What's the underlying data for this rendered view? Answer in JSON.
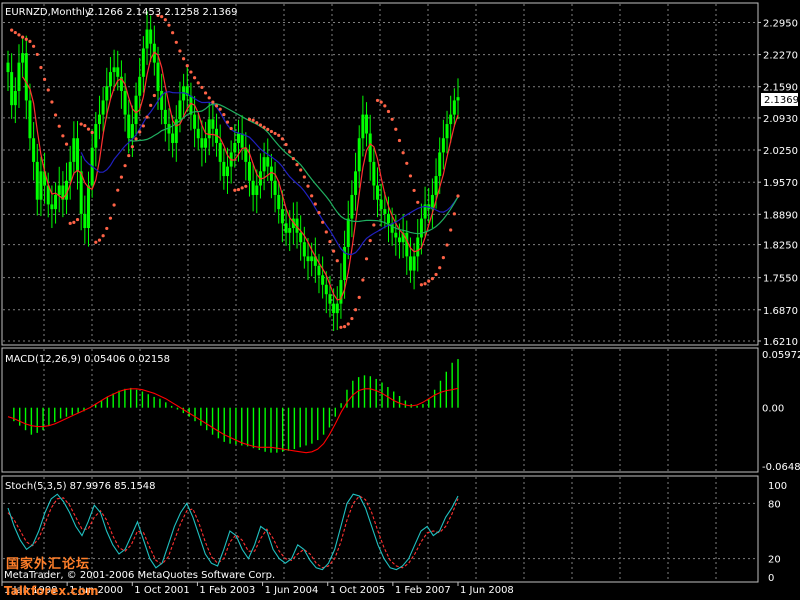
{
  "colors": {
    "background": "#000000",
    "grid": "#7f7f7f",
    "frame": "#c0c0c0",
    "text": "#ffffff",
    "candles": "#00ff00",
    "sar": "#ff6347",
    "ma_fast": "#ff3030",
    "ma_mid": "#2020c0",
    "ma_slow": "#20b060",
    "macd_hist": "#00ff00",
    "macd_signal": "#ff0000",
    "stoch_main": "#20c0c0",
    "stoch_signal": "#ff3030",
    "price_label_bg": "#ffffff",
    "price_label_text": "#000000",
    "watermark": "#ff7f2a"
  },
  "header": {
    "symbol_label": "EURNZD,Monthly",
    "ohlc_label": "2.1266 2.1453 2.1258 2.1369",
    "current_price": "2.1369"
  },
  "macd": {
    "label": "MACD(12,26,9) 0.05406 0.02158",
    "ticks": [
      "0.05972",
      "0.00",
      "-0.06483"
    ]
  },
  "stoch": {
    "label": "Stoch(5,3,5) 87.9976 85.1548",
    "ticks": [
      "100",
      "80",
      "20",
      "0"
    ]
  },
  "xaxis": {
    "labels": [
      "1 Jan 1999",
      "1 Jun 2000",
      "1 Oct 2001",
      "1 Feb 2003",
      "1 Jun 2004",
      "1 Oct 2005",
      "1 Feb 2007",
      "1 Jun 2008"
    ]
  },
  "watermark": {
    "line1": "国家外汇论坛",
    "line2": "Talkforex.com"
  },
  "copyright": "MetaTrader, © 2001-2006 MetaQuotes Software Corp.",
  "chart_data": [
    {
      "type": "candlestick",
      "title": "EURNZD,Monthly",
      "yticks": [
        "2.2950",
        "2.2270",
        "2.1590",
        "2.0930",
        "2.0250",
        "1.9570",
        "1.8890",
        "1.8250",
        "1.7550",
        "1.6870",
        "1.6210"
      ],
      "ylim": [
        1.621,
        2.315
      ],
      "x_range": [
        "Jan 1999",
        "Jun 2008"
      ],
      "close": [
        2.19,
        2.12,
        2.15,
        2.21,
        2.23,
        2.13,
        2.05,
        2.0,
        1.92,
        1.98,
        1.95,
        1.91,
        1.9,
        1.93,
        1.95,
        1.92,
        1.96,
        2.0,
        2.05,
        1.98,
        1.89,
        1.86,
        1.95,
        2.03,
        2.08,
        2.1,
        2.13,
        2.16,
        2.19,
        2.2,
        2.18,
        2.15,
        2.1,
        2.05,
        2.08,
        2.14,
        2.18,
        2.24,
        2.28,
        2.25,
        2.21,
        2.15,
        2.11,
        2.08,
        2.06,
        2.04,
        2.09,
        2.13,
        2.16,
        2.14,
        2.1,
        2.07,
        2.05,
        2.03,
        2.05,
        2.09,
        2.07,
        2.04,
        2.0,
        1.97,
        1.99,
        2.02,
        2.04,
        2.06,
        2.03,
        2.0,
        1.96,
        1.93,
        1.95,
        1.98,
        2.01,
        1.99,
        1.96,
        1.93,
        1.9,
        1.87,
        1.85,
        1.86,
        1.88,
        1.85,
        1.83,
        1.8,
        1.79,
        1.8,
        1.78,
        1.76,
        1.74,
        1.72,
        1.7,
        1.68,
        1.7,
        1.75,
        1.82,
        1.88,
        1.93,
        1.98,
        2.05,
        2.1,
        2.06,
        2.0,
        1.95,
        1.92,
        1.9,
        1.89,
        1.87,
        1.85,
        1.84,
        1.83,
        1.85,
        1.8,
        1.77,
        1.8,
        1.84,
        1.88,
        1.91,
        1.9,
        1.93,
        1.97,
        2.02,
        2.05,
        2.08,
        2.1,
        2.13,
        2.1369
      ]
    },
    {
      "type": "bar+line",
      "title": "MACD(12,26,9)",
      "ylim": [
        -0.06483,
        0.05972
      ],
      "histogram": [
        0.0,
        -0.015,
        -0.02,
        -0.025,
        -0.03,
        -0.028,
        -0.025,
        -0.02,
        -0.016,
        -0.012,
        -0.01,
        -0.008,
        -0.006,
        -0.004,
        0.0,
        0.004,
        0.008,
        0.012,
        0.016,
        0.019,
        0.021,
        0.022,
        0.02,
        0.018,
        0.015,
        0.012,
        0.01,
        0.006,
        0.002,
        -0.002,
        -0.006,
        -0.01,
        -0.015,
        -0.02,
        -0.025,
        -0.03,
        -0.034,
        -0.038,
        -0.04,
        -0.041,
        -0.042,
        -0.043,
        -0.045,
        -0.047,
        -0.049,
        -0.05,
        -0.05,
        -0.049,
        -0.048,
        -0.046,
        -0.044,
        -0.042,
        -0.04,
        -0.036,
        -0.03,
        -0.022,
        -0.01,
        0.005,
        0.02,
        0.03,
        0.034,
        0.036,
        0.035,
        0.032,
        0.028,
        0.023,
        0.018,
        0.013,
        0.008,
        0.004,
        0.002,
        0.004,
        0.01,
        0.02,
        0.03,
        0.04,
        0.05,
        0.05406
      ],
      "signal": [
        -0.01,
        -0.012,
        -0.015,
        -0.018,
        -0.02,
        -0.021,
        -0.021,
        -0.02,
        -0.018,
        -0.015,
        -0.012,
        -0.009,
        -0.006,
        -0.003,
        0.0,
        0.004,
        0.008,
        0.012,
        0.015,
        0.018,
        0.02,
        0.021,
        0.021,
        0.02,
        0.018,
        0.016,
        0.013,
        0.01,
        0.006,
        0.002,
        -0.002,
        -0.006,
        -0.01,
        -0.014,
        -0.018,
        -0.022,
        -0.026,
        -0.03,
        -0.033,
        -0.036,
        -0.039,
        -0.041,
        -0.043,
        -0.044,
        -0.044,
        -0.044,
        -0.045,
        -0.046,
        -0.047,
        -0.048,
        -0.049,
        -0.05,
        -0.049,
        -0.046,
        -0.04,
        -0.03,
        -0.018,
        -0.005,
        0.006,
        0.014,
        0.019,
        0.021,
        0.021,
        0.019,
        0.016,
        0.012,
        0.008,
        0.005,
        0.003,
        0.002,
        0.003,
        0.006,
        0.01,
        0.014,
        0.017,
        0.019,
        0.02,
        0.02158
      ]
    },
    {
      "type": "line",
      "title": "Stoch(5,3,5)",
      "ylim": [
        0,
        100
      ],
      "main": [
        75,
        55,
        40,
        30,
        35,
        50,
        70,
        85,
        90,
        82,
        70,
        55,
        45,
        60,
        78,
        70,
        50,
        35,
        25,
        30,
        45,
        60,
        40,
        20,
        10,
        15,
        35,
        55,
        70,
        80,
        65,
        45,
        25,
        15,
        12,
        30,
        50,
        45,
        30,
        20,
        35,
        55,
        50,
        30,
        20,
        15,
        20,
        35,
        30,
        18,
        10,
        8,
        15,
        30,
        55,
        80,
        90,
        88,
        75,
        55,
        35,
        20,
        10,
        8,
        12,
        20,
        35,
        50,
        55,
        45,
        50,
        65,
        75,
        87.9976
      ],
      "signal": [
        70,
        62,
        50,
        38,
        34,
        42,
        58,
        75,
        85,
        86,
        78,
        65,
        52,
        52,
        65,
        72,
        62,
        45,
        32,
        28,
        35,
        50,
        48,
        32,
        18,
        14,
        22,
        40,
        58,
        72,
        74,
        58,
        38,
        22,
        15,
        20,
        38,
        46,
        40,
        28,
        28,
        42,
        52,
        42,
        28,
        20,
        18,
        25,
        30,
        25,
        15,
        10,
        12,
        20,
        38,
        62,
        80,
        88,
        84,
        70,
        50,
        32,
        18,
        12,
        10,
        15,
        25,
        38,
        48,
        50,
        48,
        55,
        68,
        85.1548
      ]
    }
  ]
}
